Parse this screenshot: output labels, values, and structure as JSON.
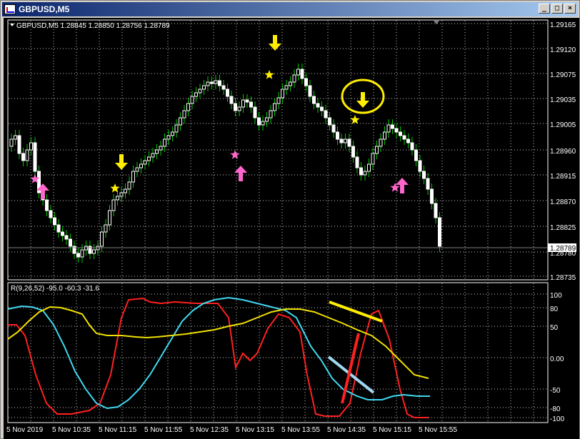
{
  "window": {
    "title": "GBPUSD,M5",
    "buttons": [
      "_",
      "□",
      "×"
    ]
  },
  "main_chart": {
    "info": "GBPUSD,M5  1.28845 1.28850 1.28756 1.28789",
    "price_labels": [
      "1.29120",
      "1.29075",
      "1.29035",
      "1.29005",
      "1.28960",
      "1.28915",
      "1.28870",
      "1.28825",
      "1.28780",
      "1.28735"
    ],
    "current_price": "1.28789",
    "candle_color_bull": "#ffffff",
    "candle_color_bear": "#ffffff",
    "wick_color": "#00c800",
    "background": "#000000",
    "grid_color": "#c0c0c0"
  },
  "indicator": {
    "info": "R(9,26,52) -95.0 -60.3 -31.6",
    "levels": [
      "100",
      "80",
      "50",
      "0.00",
      "-50",
      "-80",
      "-100"
    ],
    "colors": {
      "fast": "#ff2020",
      "mid": "#40d8f0",
      "slow": "#f0e000"
    }
  },
  "time_labels": [
    "5 Nov 2019",
    "5 Nov 10:35",
    "5 Nov 11:15",
    "5 Nov 11:55",
    "5 Nov 12:35",
    "5 Nov 13:15",
    "5 Nov 13:55",
    "5 Nov 14:35",
    "5 Nov 15:15",
    "5 Nov 15:55"
  ],
  "annotations": {
    "down_arrow_color": "#ffee00",
    "up_arrow_color": "#ff66cc",
    "star_down_color": "#ffee00",
    "star_up_color": "#ff66cc"
  }
}
